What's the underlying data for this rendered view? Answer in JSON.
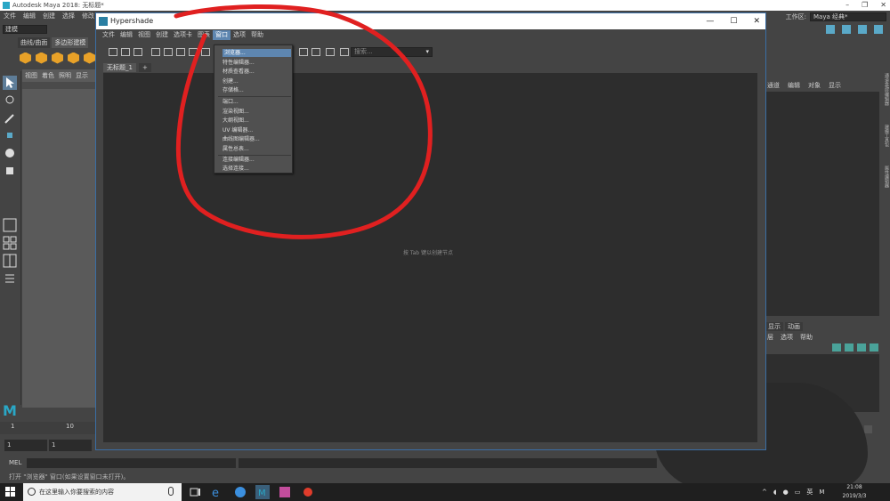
{
  "maya": {
    "title": "Autodesk Maya 2018: 无标题*",
    "menu": [
      "文件",
      "编辑",
      "创建",
      "选择",
      "修改"
    ],
    "workspace_label": "工作区:",
    "workspace_value": "Maya 经典*",
    "mode": "建模",
    "shelf_tabs": [
      "曲线/曲面",
      "多边形建模"
    ],
    "viewport_menu": [
      "视图",
      "着色",
      "照明",
      "显示"
    ],
    "range_start": "1",
    "range_current": "1",
    "timeline_ticks": [
      "1",
      "10"
    ],
    "mel_label": "MEL",
    "help_line": "打开 \"浏览器\" 窗口(如果设置窗口未打开)。"
  },
  "right_panel": {
    "channel_menu": [
      "通道",
      "编辑",
      "对象",
      "显示"
    ],
    "layer_tabs": [
      "显示",
      "动画"
    ],
    "layer_menu": [
      "层",
      "选项",
      "帮助"
    ],
    "side_tabs": [
      "通道盒/层编辑器",
      "建模工具包",
      "属性编辑器"
    ]
  },
  "hypershade": {
    "title": "Hypershade",
    "menubar": [
      "文件",
      "编辑",
      "视图",
      "创建",
      "选项卡",
      "图表",
      "窗口",
      "选项",
      "帮助"
    ],
    "active_menu": "窗口",
    "search_placeholder": "搜索...",
    "tab_label": "无标题_1",
    "add_tab": "+",
    "graph_hint": "按 Tab 键以创建节点"
  },
  "window_menu": {
    "items": [
      "浏览器...",
      "特性编辑器...",
      "材质查看器...",
      "创建...",
      "存储格...",
      "端口...",
      "渲染视图...",
      "大纲视图...",
      "UV 编辑器...",
      "曲线图编辑器...",
      "属性总表...",
      "连接编辑器...",
      "选择连接..."
    ],
    "highlighted_index": 0
  },
  "taskbar": {
    "search_placeholder": "在这里输入你要搜索的内容",
    "ime": "英",
    "time": "21:08",
    "date": "2019/3/3"
  },
  "colors": {
    "annotation_red": "#e02020",
    "menu_highlight": "#5e86b0",
    "maya_accent": "#2aa7c6"
  }
}
